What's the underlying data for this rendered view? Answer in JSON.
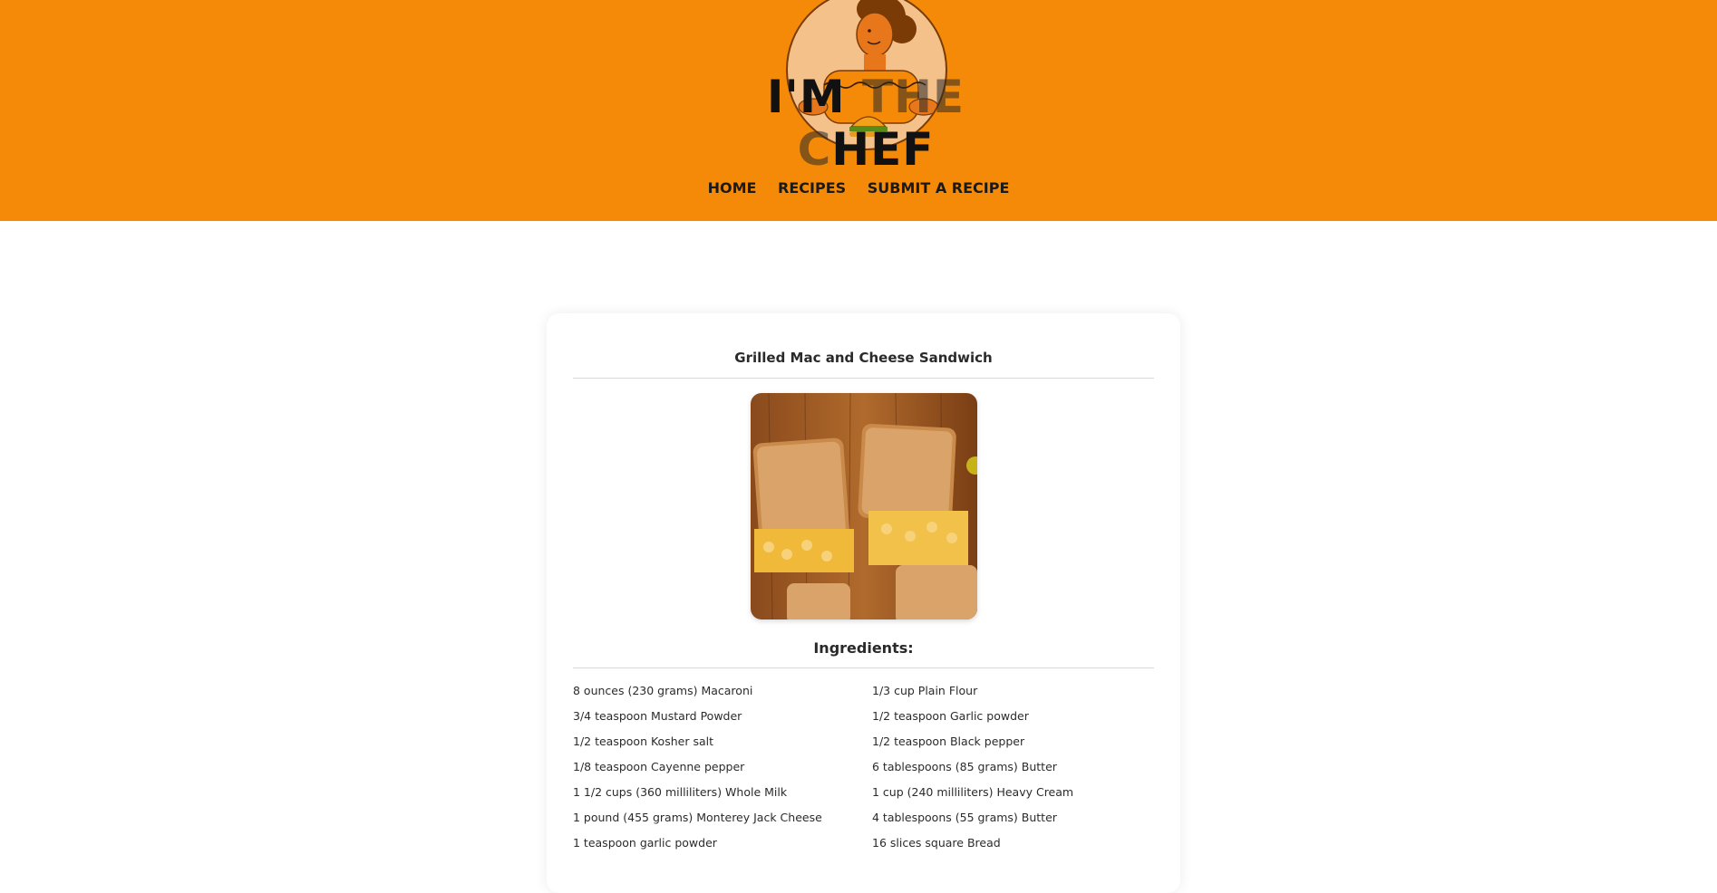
{
  "header": {
    "logo_text_a": "I'M ",
    "logo_text_b": "THE C",
    "logo_text_c": "HEF",
    "brand_color": "#f48a07"
  },
  "nav": {
    "home": "HOME",
    "recipes": "RECIPES",
    "submit": "SUBMIT A RECIPE"
  },
  "recipe": {
    "title": "Grilled Mac and Cheese Sandwich",
    "ingredients_heading": "Ingredients:",
    "ingredients": [
      "8 ounces (230 grams) Macaroni",
      "1/3 cup Plain Flour",
      "3/4 teaspoon Mustard Powder",
      "1/2 teaspoon Garlic powder",
      "1/2 teaspoon Kosher salt",
      "1/2 teaspoon Black pepper",
      "1/8 teaspoon Cayenne pepper",
      "6 tablespoons (85 grams) Butter",
      "1 1/2 cups (360 milliliters) Whole Milk",
      "1 cup (240 milliliters) Heavy Cream",
      "1 pound (455 grams) Monterey Jack Cheese",
      "4 tablespoons (55 grams) Butter",
      "1 teaspoon garlic powder",
      "16 slices square Bread"
    ]
  }
}
